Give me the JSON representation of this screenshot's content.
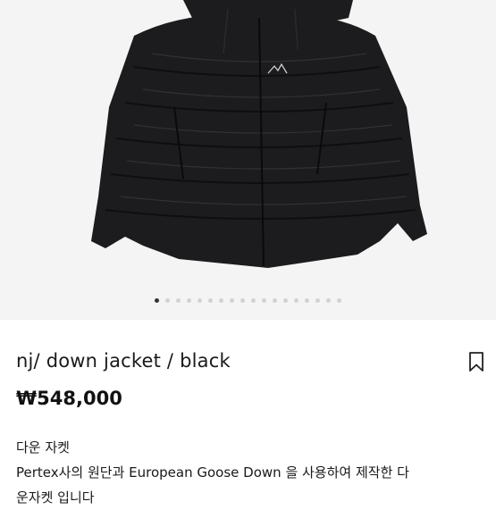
{
  "product": {
    "title": "nj/ down jacket / black",
    "price": "₩548,000",
    "description_lines": [
      "다운 자켓",
      "Pertex사의 원단과 European Goose Down 을 사용하여 제작한 다",
      "운자켓 입니다"
    ]
  },
  "carousel": {
    "total": 18,
    "active_index": 0
  },
  "icons": {
    "bookmark": "bookmark-icon"
  },
  "colors": {
    "jacket": "#1c1c1e",
    "background": "#f4f4f4",
    "dot_active": "#333333",
    "dot_inactive": "#d2d2d2"
  }
}
